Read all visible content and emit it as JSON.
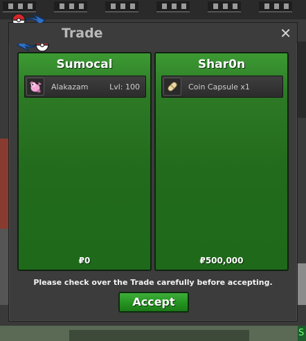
{
  "window": {
    "title": "Trade",
    "close_glyph": "✕"
  },
  "players": [
    {
      "name": "Sumocal",
      "items": [
        {
          "name": "Alakazam",
          "level": "Lvl: 100",
          "icon": "pokemon-sprite-icon"
        }
      ],
      "money": "₽0"
    },
    {
      "name": "Shar0n",
      "items": [
        {
          "name": "Coin Capsule  x1",
          "icon": "coin-capsule-icon"
        }
      ],
      "money": "₽500,000"
    }
  ],
  "notice": "Please check over the Trade carefully before accepting.",
  "accept_label": "Accept",
  "colors": {
    "panel_green": "#2d7a26",
    "accept_green": "#249320",
    "window_bg": "#3c3c3c",
    "title_text": "#b9b9b9"
  }
}
